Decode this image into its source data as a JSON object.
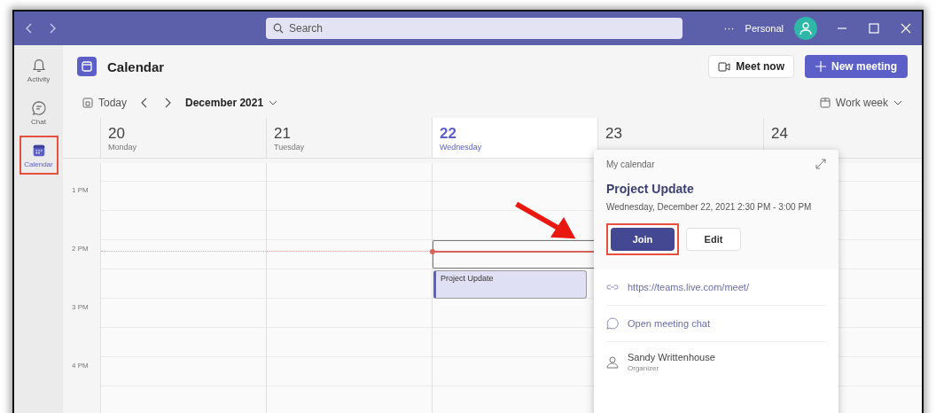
{
  "titlebar": {
    "search_placeholder": "Search",
    "more": "···",
    "account": "Personal"
  },
  "sidebar": {
    "items": [
      {
        "label": "Activity",
        "kind": "bell",
        "selected": false
      },
      {
        "label": "Chat",
        "kind": "chat",
        "selected": false
      },
      {
        "label": "Calendar",
        "kind": "calendar",
        "selected": true
      }
    ]
  },
  "header": {
    "title": "Calendar",
    "meet_now": "Meet now",
    "new_meeting": "New meeting"
  },
  "toolbar": {
    "today": "Today",
    "month": "December 2021",
    "view": "Work week"
  },
  "days": [
    {
      "date": "20",
      "weekday": "Monday",
      "selected": false
    },
    {
      "date": "21",
      "weekday": "Tuesday",
      "selected": false
    },
    {
      "date": "22",
      "weekday": "Wednesday",
      "selected": true,
      "events": [
        {
          "title": "Project Update"
        }
      ]
    },
    {
      "date": "23",
      "selected": false
    },
    {
      "date": "24",
      "selected": false
    }
  ],
  "hours": [
    "1 PM",
    "2 PM",
    "3 PM",
    "4 PM"
  ],
  "popup": {
    "calendar": "My calendar",
    "title": "Project Update",
    "when": "Wednesday, December 22, 2021 2:30 PM - 3:00 PM",
    "join": "Join",
    "edit": "Edit",
    "link": "https://teams.live.com/meet/",
    "chat": "Open meeting chat",
    "organizer": {
      "name": "Sandy Writtenhouse",
      "role": "Organizer"
    }
  }
}
